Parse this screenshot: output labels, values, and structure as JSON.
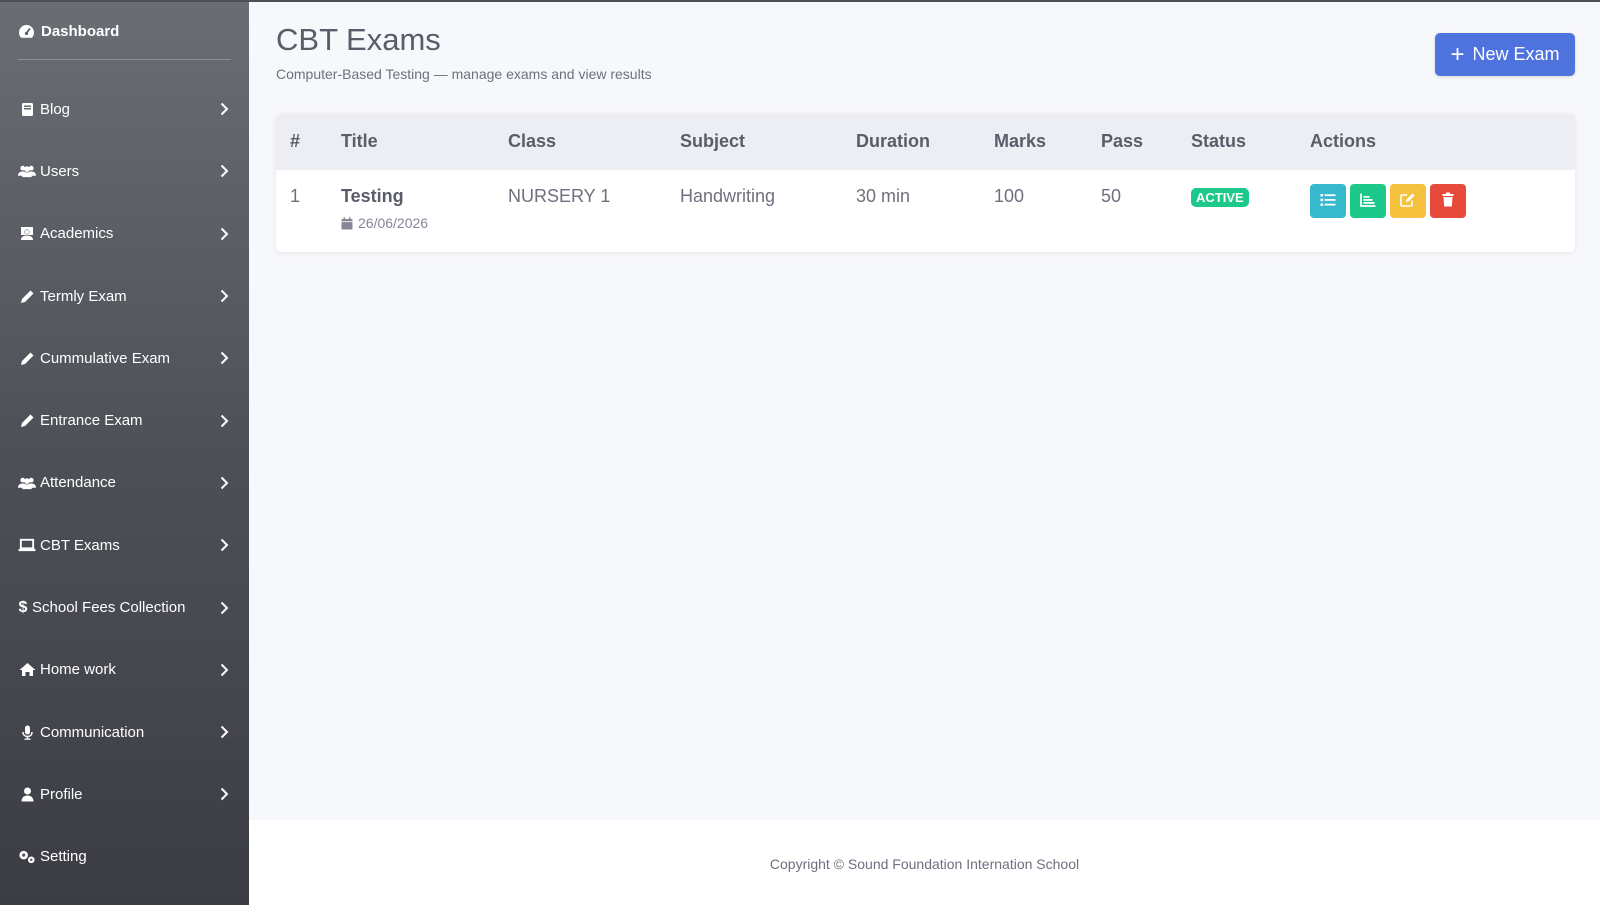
{
  "sidebar": {
    "brand": {
      "label": "Dashboard",
      "icon": "dashboard-icon"
    },
    "items": [
      {
        "label": "Blog",
        "icon": "book-icon"
      },
      {
        "label": "Users",
        "icon": "users-icon"
      },
      {
        "label": "Academics",
        "icon": "teacher-icon"
      },
      {
        "label": "Termly Exam",
        "icon": "pencil-icon"
      },
      {
        "label": "Cummulative Exam",
        "icon": "pencil-icon"
      },
      {
        "label": "Entrance Exam",
        "icon": "pencil-icon"
      },
      {
        "label": "Attendance",
        "icon": "users-icon"
      },
      {
        "label": "CBT Exams",
        "icon": "laptop-icon"
      },
      {
        "label": "School Fees Collection",
        "icon": "dollar-icon"
      },
      {
        "label": "Home work",
        "icon": "home-icon"
      },
      {
        "label": "Communication",
        "icon": "microphone-icon"
      },
      {
        "label": "Profile",
        "icon": "user-icon"
      },
      {
        "label": "Setting",
        "icon": "cogs-icon"
      }
    ]
  },
  "header": {
    "title": "CBT Exams",
    "subtitle": "Computer-Based Testing — manage exams and view results",
    "new_button": "New Exam"
  },
  "table": {
    "columns": [
      "#",
      "Title",
      "Class",
      "Subject",
      "Duration",
      "Marks",
      "Pass",
      "Status",
      "Actions"
    ],
    "rows": [
      {
        "num": "1",
        "title": "Testing",
        "date": "26/06/2026",
        "class": "NURSERY 1",
        "subject": "Handwriting",
        "duration": "30 min",
        "marks": "100",
        "pass": "50",
        "status": "ACTIVE",
        "actions": [
          "questions-list-icon",
          "results-chart-icon",
          "edit-icon",
          "delete-icon"
        ]
      }
    ]
  },
  "footer": {
    "text": "Copyright © Sound Foundation Internation School"
  },
  "colors": {
    "primary": "#4e73df",
    "success": "#1cc88a",
    "info": "#36b9cc",
    "warning": "#f6c23e",
    "danger": "#e74a3b"
  }
}
